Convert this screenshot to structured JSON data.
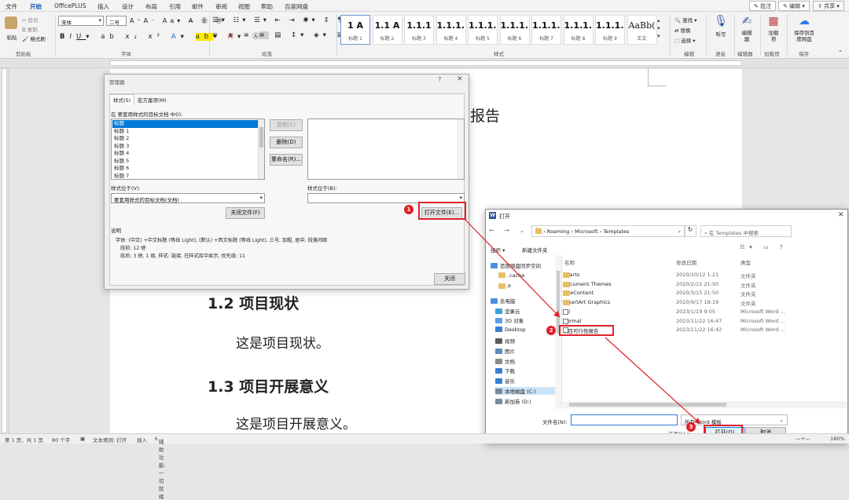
{
  "menu": {
    "items": [
      "文件",
      "开始",
      "OfficePLUS",
      "插入",
      "设计",
      "布局",
      "引用",
      "邮件",
      "审阅",
      "视图",
      "帮助",
      "百度网盘"
    ],
    "active": "开始"
  },
  "topbar": {
    "comment": "批注",
    "edit": "编辑",
    "share": "共享"
  },
  "ribbon": {
    "groups": {
      "clipboard": "剪贴板",
      "font": "字体",
      "paragraph": "段落",
      "styles": "样式",
      "editing": "编辑",
      "voice": "语音",
      "editor": "编辑器",
      "addins": "加载项",
      "save": "保存"
    },
    "clipboard": {
      "paste": "粘贴",
      "cut": "剪切",
      "copy": "复制",
      "painter": "格式刷"
    },
    "font": {
      "name": "宋体",
      "size": "二号"
    },
    "styles": [
      {
        "preview": "1 A",
        "name": "标题 1"
      },
      {
        "preview": "1.1 A",
        "name": "标题 2"
      },
      {
        "preview": "1.1.1",
        "name": "标题 3"
      },
      {
        "preview": "1.1.1.1",
        "name": "标题 4"
      },
      {
        "preview": "1.1.1.1.",
        "name": "标题 5"
      },
      {
        "preview": "1.1.1.1",
        "name": "标题 6"
      },
      {
        "preview": "1.1.1.1.",
        "name": "标题 7"
      },
      {
        "preview": "1.1.1.1",
        "name": "标题 8"
      },
      {
        "preview": "1.1.1.1",
        "name": "标题 9"
      },
      {
        "preview": "AaBb(",
        "name": "正文"
      }
    ],
    "editing": {
      "find": "查找",
      "replace": "替换",
      "select": "选择"
    },
    "voice": "听写",
    "editor": "编辑器",
    "addins": "加载项",
    "save": "保存到百度网盘"
  },
  "document": {
    "heading_tail": "报告",
    "h12": "1.2  项目现状",
    "p12": "这是项目现状。",
    "h13": "1.3  项目开展意义",
    "p13": "这是项目开展意义。"
  },
  "organizer": {
    "title": "管理器",
    "tabs": [
      "样式(S)",
      "宏方案项(M)"
    ],
    "left_label": "在 要套用样式的目标文档 中(I):",
    "left_items": [
      "标题",
      "标题 1",
      "标题 2",
      "标题 3",
      "标题 4",
      "标题 5",
      "标题 6",
      "标题 7"
    ],
    "selected": "标题",
    "copy": "复制(C)",
    "delete": "删除(D)",
    "rename": "重命名(R)...",
    "left_loc_label": "样式位于(V):",
    "left_loc_value": "要套用样式的目标文档(文档)",
    "right_loc_label": "样式位于(B):",
    "close_file": "关闭文件(F)",
    "open_file": "打开文件(E)...",
    "desc_label": "说明",
    "desc_lines": [
      "字体: (中文) +中文标题 (等线 Light), (默认) +西文标题 (等线 Light), 三号, 加粗, 居中, 段落间距",
      "段前: 12 磅",
      "段后: 3 磅, 1 级, 样式: 链接, 在样式库中显示, 优先级: 11"
    ],
    "close": "关闭"
  },
  "open_dialog": {
    "title": "打开",
    "path": [
      "Roaming",
      "Microsoft",
      "Templates"
    ],
    "search_placeholder": "在 Templates 中搜索",
    "organize": "组织 ▾",
    "new_folder": "新建文件夹",
    "nav": [
      {
        "name": "百度网盘同步空间",
        "color": "#4c8fe0"
      },
      {
        "name": ".cache",
        "color": "#e8c062"
      },
      {
        "name": "P",
        "color": "#e8c062"
      },
      {
        "name": "此电脑",
        "color": "#4c8fe0"
      },
      {
        "name": "坚果云",
        "color": "#3aa0d8"
      },
      {
        "name": "3D 对象",
        "color": "#5aa0e0"
      },
      {
        "name": "Desktop",
        "color": "#3a7fd0"
      },
      {
        "name": "视频",
        "color": "#5a5a5a"
      },
      {
        "name": "图片",
        "color": "#5a8ac0"
      },
      {
        "name": "文档",
        "color": "#8a8a8a"
      },
      {
        "name": "下载",
        "color": "#3a7fd0"
      },
      {
        "name": "音乐",
        "color": "#3a7fd0"
      },
      {
        "name": "本地磁盘 (C:)",
        "color": "#7a8a9a"
      },
      {
        "name": "新加卷 (D:)",
        "color": "#7a8a9a"
      }
    ],
    "columns": [
      "名称",
      "修改日期",
      "类型"
    ],
    "files": [
      {
        "name": "Charts",
        "date": "2020/10/12 1:21",
        "type": "文件夹",
        "kind": "folder"
      },
      {
        "name": "Document Themes",
        "date": "2020/2/15 21:50",
        "type": "文件夹",
        "kind": "folder"
      },
      {
        "name": "LiveContent",
        "date": "2020/3/15 21:50",
        "type": "文件夹",
        "kind": "folder"
      },
      {
        "name": "SmartArt Graphics",
        "date": "2020/9/17 18:19",
        "type": "文件夹",
        "kind": "folder"
      },
      {
        "name": "biji",
        "date": "2023/1/19 9:05",
        "type": "Microsoft Word ...",
        "kind": "doc"
      },
      {
        "name": "Normal",
        "date": "2023/11/22 16:47",
        "type": "Microsoft Word ...",
        "kind": "doc"
      },
      {
        "name": "项目可行性报告",
        "date": "2023/11/22 16:42",
        "type": "Microsoft Word ...",
        "kind": "doc"
      }
    ],
    "filename_label": "文件名(N):",
    "filter": "所有 Word 模板",
    "tools": "工具(L)",
    "open": "打开(O)",
    "cancel": "取消"
  },
  "callouts": [
    "1",
    "2",
    "3"
  ],
  "status": {
    "page": "第 1 页，共 1 页",
    "words": "80 个字",
    "predict": "文本预测: 打开",
    "insert": "插入",
    "accessibility": "辅助功能: 一切就绪",
    "zoom": "180%"
  }
}
